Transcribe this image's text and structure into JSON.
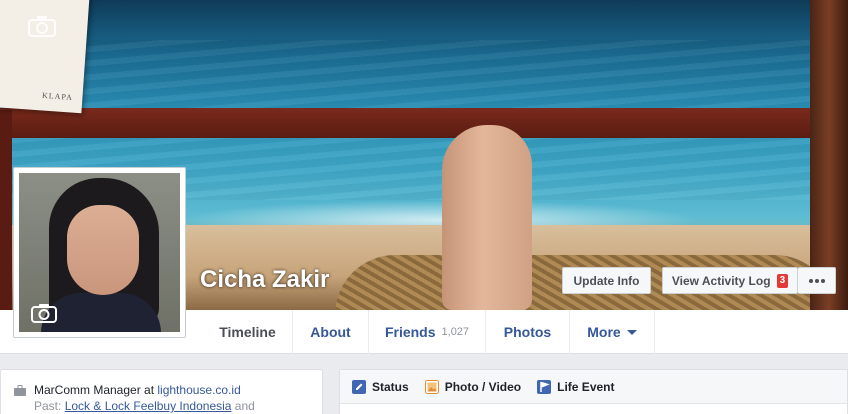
{
  "cover": {
    "camera_icon": "camera-icon",
    "paper_text": "KLAPA"
  },
  "profile": {
    "name": "Cicha Zakir",
    "camera_icon": "camera-icon"
  },
  "actions": {
    "update_info": "Update Info",
    "view_activity_log": "View Activity Log",
    "activity_badge": "3",
    "more_icon": "more-dots-icon"
  },
  "nav": {
    "timeline": "Timeline",
    "about": "About",
    "friends": "Friends",
    "friends_count": "1,027",
    "photos": "Photos",
    "more": "More"
  },
  "intro": {
    "work_prefix": "MarComm Manager at ",
    "work_link": "lighthouse.co.id",
    "past_prefix": "Past: ",
    "past_link": "Lock & Lock Feelbuy Indonesia",
    "past_suffix": " and"
  },
  "composer": {
    "status": "Status",
    "photo_video": "Photo / Video",
    "life_event": "Life Event"
  },
  "colors": {
    "link": "#365899",
    "badge": "#e53935",
    "nav_bg": "#ffffff",
    "page_bg": "#e9ebee"
  }
}
